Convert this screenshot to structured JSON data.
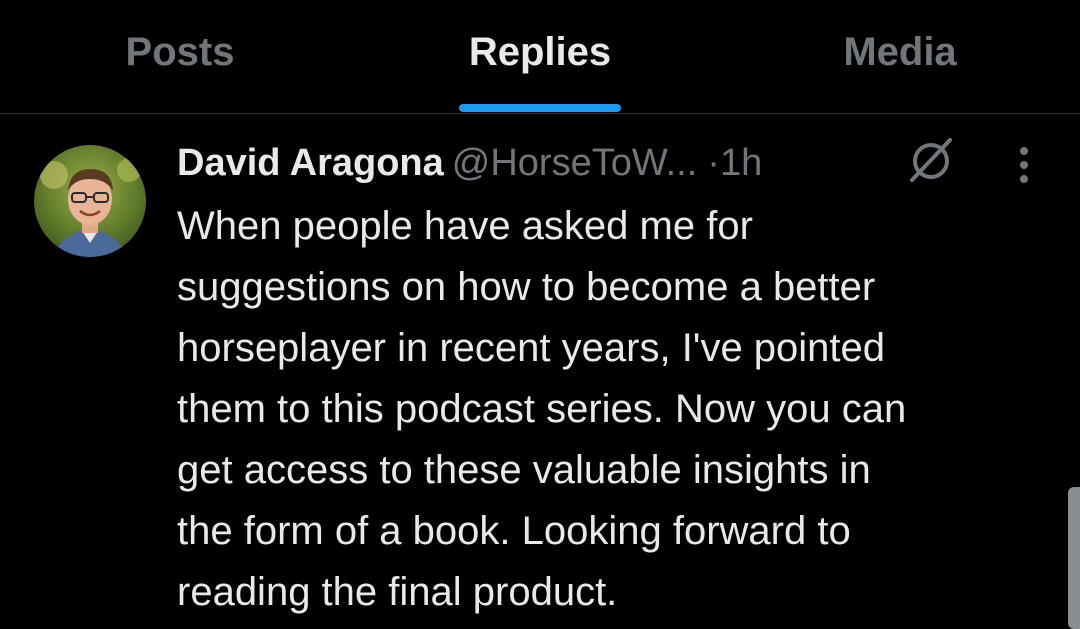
{
  "tabs": [
    {
      "label": "Posts",
      "active": false
    },
    {
      "label": "Replies",
      "active": true
    },
    {
      "label": "Media",
      "active": false
    }
  ],
  "tweet": {
    "author_name": "David Aragona",
    "author_handle": "@HorseToW...",
    "separator": "·",
    "timestamp": "1h",
    "text": "When people have asked me for\nsuggestions on how to become a better\nhorseplayer in recent years, I've pointed\nthem to this podcast series. Now you can\nget access to these valuable insights in\nthe form of a book. Looking forward to\nreading the final product."
  },
  "icons": {
    "grok": "grok-icon",
    "more": "more-icon",
    "avatar": "avatar"
  },
  "colors": {
    "background": "#000000",
    "text_primary": "#e7e9ea",
    "text_secondary": "#71767b",
    "accent": "#1d9bf0",
    "divider": "#2f3336"
  }
}
